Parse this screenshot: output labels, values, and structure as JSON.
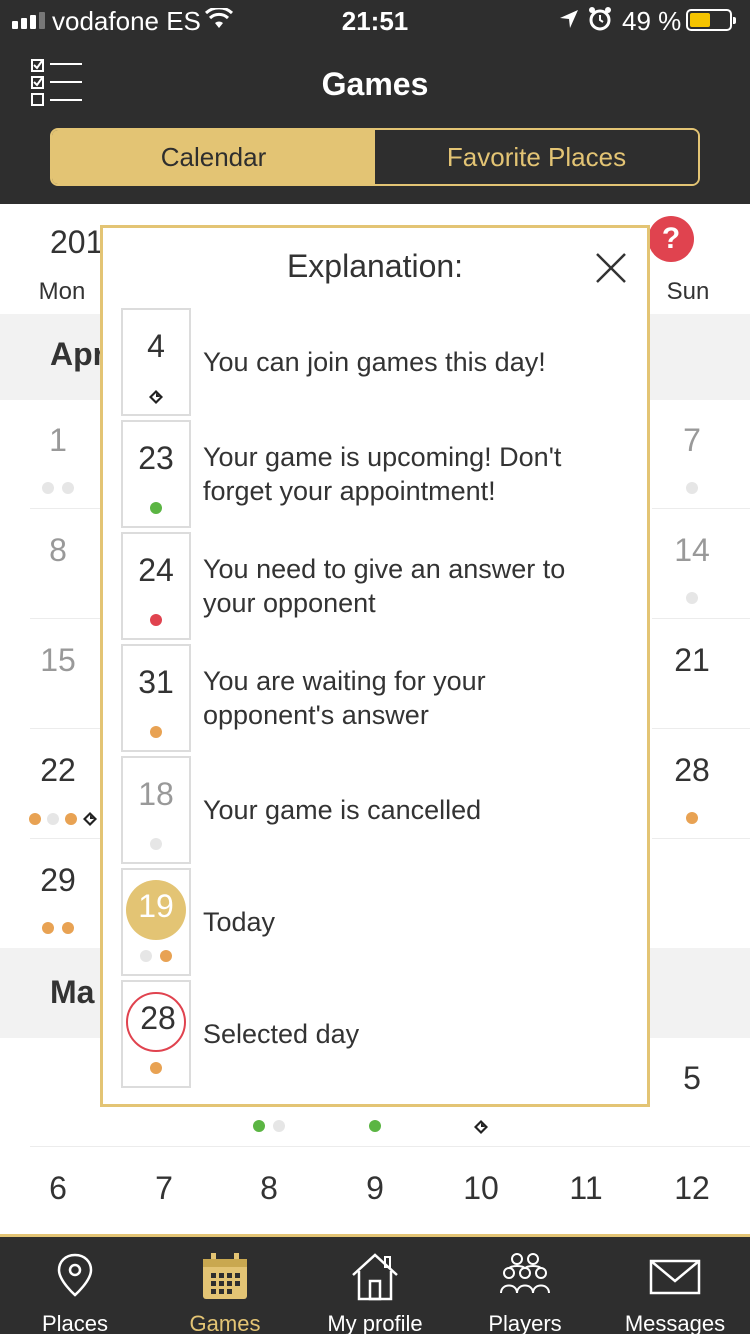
{
  "status_bar": {
    "carrier": "vodafone ES",
    "time": "21:51",
    "battery_percent": "49 %",
    "battery_level": 0.49,
    "icons": [
      "signal-icon",
      "wifi-icon",
      "location-icon",
      "alarm-icon",
      "battery-icon"
    ]
  },
  "header": {
    "title": "Games",
    "menu_icon": "checklist-icon",
    "tabs": [
      {
        "label": "Calendar",
        "active": true
      },
      {
        "label": "Favorite Places",
        "active": false
      }
    ]
  },
  "calendar": {
    "year_visible": "201",
    "help_label": "?",
    "weekday_first": "Mon",
    "weekday_last": "Sun",
    "month_april_visible": "Apr",
    "month_may_visible": "Ma",
    "april_left_days": [
      "1",
      "8",
      "15",
      "22",
      "29"
    ],
    "april_right_days": [
      "7",
      "14",
      "21",
      "28"
    ],
    "may_first_row_right": "5",
    "may_second_row": [
      "6",
      "7",
      "8",
      "9",
      "10",
      "11",
      "12"
    ]
  },
  "modal": {
    "title": "Explanation:",
    "close_icon": "close-icon",
    "rows": [
      {
        "day": "4",
        "text": "You can join games this day!",
        "marker": "diamond"
      },
      {
        "day": "23",
        "text": "Your game is upcoming! Don't forget your appointment!",
        "marker": "green"
      },
      {
        "day": "24",
        "text": "You need to give an answer to your opponent",
        "marker": "red"
      },
      {
        "day": "31",
        "text": "You are waiting for your opponent's answer",
        "marker": "orange"
      },
      {
        "day": "18",
        "text": "Your game is cancelled",
        "marker": "gray"
      },
      {
        "day": "19",
        "text": "Today",
        "marker": "gray+orange"
      },
      {
        "day": "28",
        "text": "Selected day",
        "marker": "orange"
      }
    ]
  },
  "tabbar": {
    "items": [
      {
        "label": "Places",
        "icon": "map-pin-icon",
        "active": false
      },
      {
        "label": "Games",
        "icon": "calendar-icon",
        "active": true
      },
      {
        "label": "My profile",
        "icon": "home-icon",
        "active": false
      },
      {
        "label": "Players",
        "icon": "group-icon",
        "active": false
      },
      {
        "label": "Messages",
        "icon": "envelope-icon",
        "active": false
      }
    ]
  },
  "colors": {
    "dark": "#2e2e2e",
    "gold": "#e3c474",
    "red": "#e0434f",
    "green": "#5bb543",
    "orange": "#e8a253",
    "gray_dot": "#e6e6e6"
  }
}
